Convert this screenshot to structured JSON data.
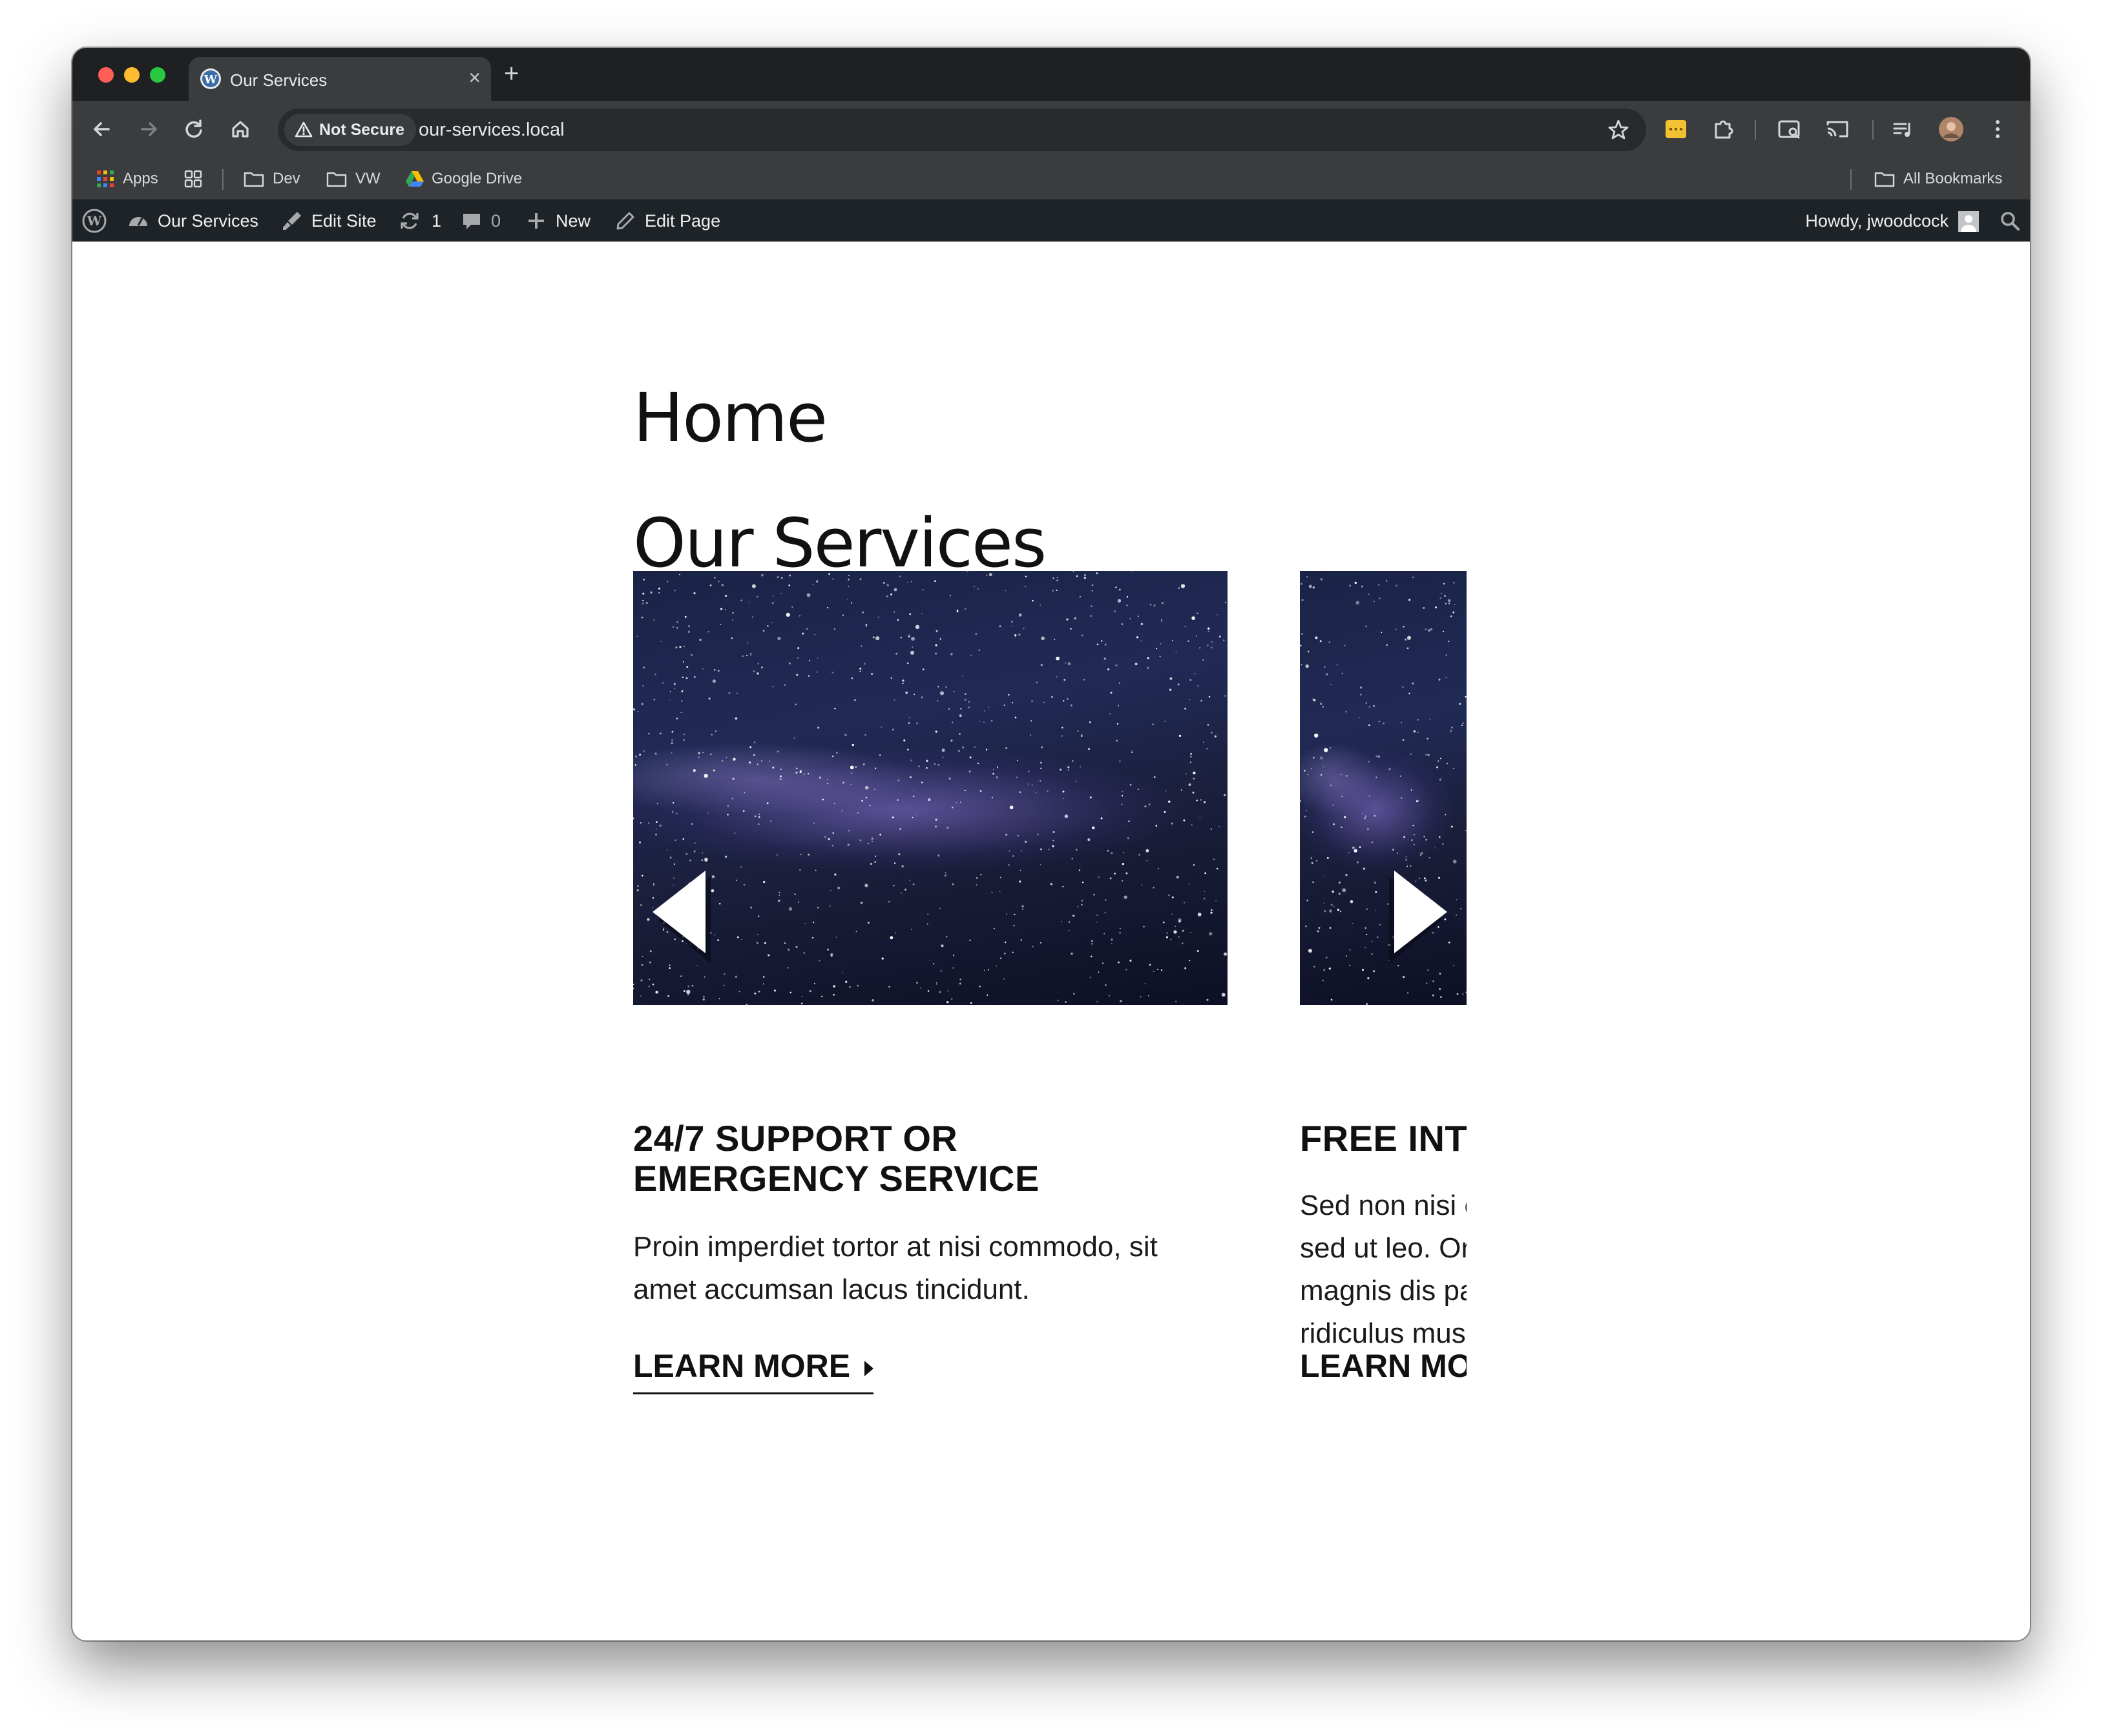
{
  "browser": {
    "tab": {
      "title": "Our Services",
      "close": "×"
    },
    "new_tab": "+",
    "security_label": "Not Secure",
    "url": "our-services.local",
    "bookmarks": [
      {
        "label": "Apps"
      },
      {
        "label": "Dev"
      },
      {
        "label": "VW"
      },
      {
        "label": "Google Drive"
      }
    ],
    "all_bookmarks": "All Bookmarks"
  },
  "adminbar": {
    "site_name": "Our Services",
    "edit_site": "Edit Site",
    "updates_count": "1",
    "comments_count": "0",
    "new_label": "New",
    "edit_page": "Edit Page",
    "howdy": "Howdy, jwoodcock"
  },
  "page": {
    "title": "Home",
    "section_heading": "Our Services",
    "cards": [
      {
        "title_line1": "24/7 SUPPORT OR",
        "title_line2": "EMERGENCY SERVICE",
        "body_line1": "Proin imperdiet tortor at nisi commodo, sit",
        "body_line2": "amet accumsan lacus tincidunt.",
        "cta": "LEARN MORE"
      },
      {
        "title_line1": "FREE INTR",
        "body_line1": "Sed non nisi e",
        "body_line2": "sed ut leo. Or",
        "body_line3": "magnis dis pa",
        "body_line4": "ridiculus mus",
        "cta": "LEARN MOR"
      }
    ]
  },
  "colors": {
    "chrome_dark": "#1f2022",
    "toolbar": "#3b3c3e",
    "adminbar": "#1d2327",
    "text": "#111111"
  }
}
